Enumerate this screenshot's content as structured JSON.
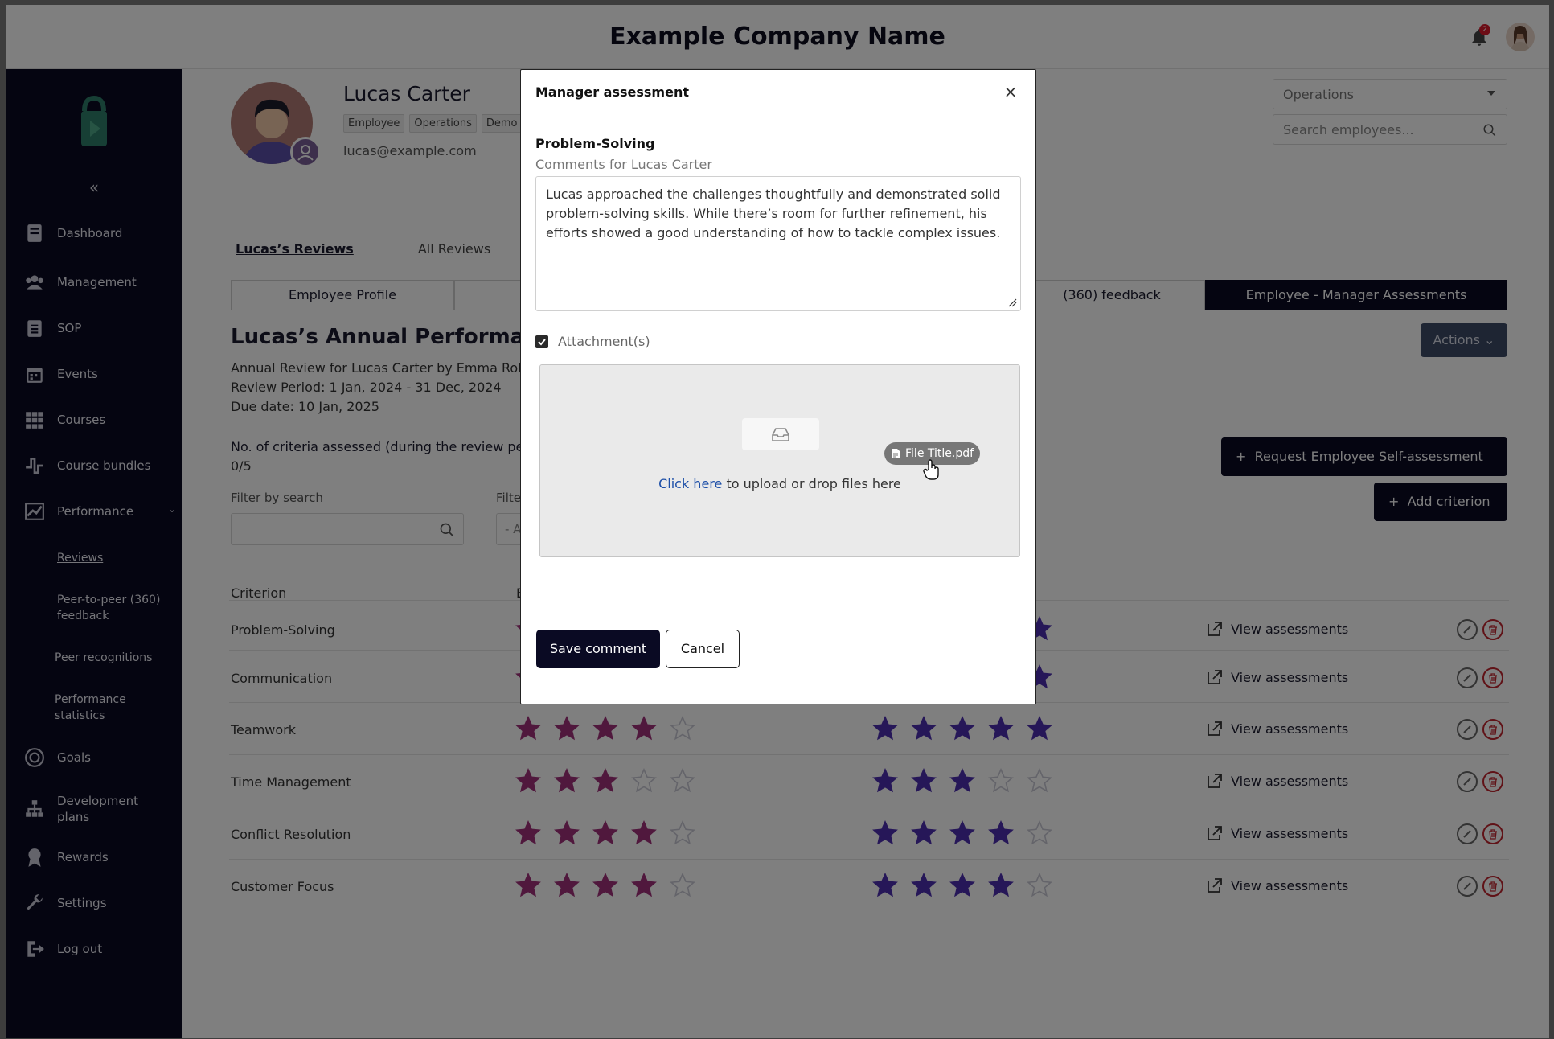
{
  "header": {
    "company": "Example Company Name",
    "notification_count": "2"
  },
  "sidebar": {
    "collapse": "«",
    "items": [
      {
        "label": "Dashboard",
        "icon": "dashboard-icon"
      },
      {
        "label": "Management",
        "icon": "people-icon"
      },
      {
        "label": "SOP",
        "icon": "clipboard-icon"
      },
      {
        "label": "Events",
        "icon": "calendar-icon"
      },
      {
        "label": "Courses",
        "icon": "grid-icon"
      },
      {
        "label": "Course bundles",
        "icon": "bundle-icon"
      },
      {
        "label": "Performance",
        "icon": "chart-icon"
      },
      {
        "label": "Goals",
        "icon": "target-icon"
      },
      {
        "label": "Development plans",
        "icon": "hierarchy-icon"
      },
      {
        "label": "Rewards",
        "icon": "award-icon"
      },
      {
        "label": "Settings",
        "icon": "wrench-icon"
      },
      {
        "label": "Log out",
        "icon": "logout-icon"
      }
    ],
    "sub_items": [
      {
        "label": "Reviews"
      },
      {
        "label": "Peer-to-peer (360) feedback"
      },
      {
        "label": "Peer recognitions"
      },
      {
        "label": "Performance statistics"
      }
    ]
  },
  "profile": {
    "name": "Lucas Carter",
    "chips": [
      "Employee",
      "Operations",
      "Demo"
    ],
    "email": "lucas@example.com"
  },
  "filters": {
    "department": "Operations",
    "search_placeholder": "Search employees..."
  },
  "tabs": [
    "Lucas’s Reviews",
    "All Reviews"
  ],
  "segments": [
    "Employee Profile",
    "(360) feedback",
    "Employee - Manager Assessments"
  ],
  "review": {
    "title": "Lucas’s Annual Performance",
    "line1": "Annual Review for Lucas Carter by Emma Rob",
    "line2": "Review Period: 1 Jan, 2024 - 31 Dec, 2024",
    "line3": "Due date: 10 Jan, 2025",
    "criteria_label": "No. of criteria assessed (during the review pe",
    "criteria_count": "0/5",
    "actions": "Actions",
    "request_btn": "Request Employee Self-assessment",
    "add_btn": "Add criterion",
    "filter_label": "Filter by search",
    "filter2_label": "Filter",
    "filter2_value": "- A"
  },
  "table": {
    "col_criterion": "Criterion",
    "col_e": "E",
    "view_label": "View assessments",
    "rows": [
      {
        "name": "Problem-Solving",
        "emp": 5,
        "mgr": 5
      },
      {
        "name": "Communication",
        "emp": 5,
        "mgr": 5
      },
      {
        "name": "Teamwork",
        "emp": 4,
        "mgr": 5
      },
      {
        "name": "Time Management",
        "emp": 3,
        "mgr": 3
      },
      {
        "name": "Conflict Resolution",
        "emp": 4,
        "mgr": 4
      },
      {
        "name": "Customer Focus",
        "emp": 4,
        "mgr": 4
      }
    ],
    "colors": {
      "employee_star": "#a0307a",
      "manager_star": "#4d2fb0",
      "empty_star": "#c8c8d4"
    }
  },
  "modal": {
    "title": "Manager assessment",
    "close": "×",
    "criterion": "Problem-Solving",
    "comments_label": "Comments for Lucas Carter",
    "comment_text": "Lucas approached the challenges thoughtfully and demonstrated solid problem-solving skills. While there’s room for further refinement, his efforts showed a good understanding of how to tackle complex issues.",
    "attachment_label": "Attachment(s)",
    "upload_link": "Click here",
    "upload_text": " to upload or drop files here",
    "file_chip": "File Title.pdf",
    "save": "Save comment",
    "cancel": "Cancel"
  }
}
